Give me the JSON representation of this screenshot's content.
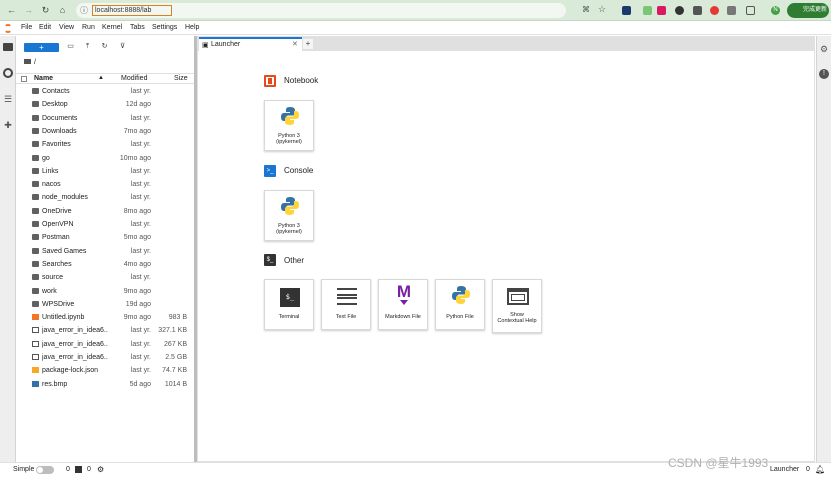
{
  "browser": {
    "url": "localhost:8888/lab",
    "update_label": "完成更新",
    "avatar": "N"
  },
  "menu": [
    "File",
    "Edit",
    "View",
    "Run",
    "Kernel",
    "Tabs",
    "Settings",
    "Help"
  ],
  "filebrowser": {
    "new_label": "+",
    "breadcrumb": "/",
    "col_name": "Name",
    "col_modified": "Modified",
    "col_size": "Size",
    "files": [
      {
        "name": "Contacts",
        "modified": "last yr.",
        "size": "",
        "type": "folder"
      },
      {
        "name": "Desktop",
        "modified": "12d ago",
        "size": "",
        "type": "folder"
      },
      {
        "name": "Documents",
        "modified": "last yr.",
        "size": "",
        "type": "folder"
      },
      {
        "name": "Downloads",
        "modified": "7mo ago",
        "size": "",
        "type": "folder"
      },
      {
        "name": "Favorites",
        "modified": "last yr.",
        "size": "",
        "type": "folder"
      },
      {
        "name": "go",
        "modified": "10mo ago",
        "size": "",
        "type": "folder"
      },
      {
        "name": "Links",
        "modified": "last yr.",
        "size": "",
        "type": "folder"
      },
      {
        "name": "nacos",
        "modified": "last yr.",
        "size": "",
        "type": "folder"
      },
      {
        "name": "node_modules",
        "modified": "last yr.",
        "size": "",
        "type": "folder"
      },
      {
        "name": "OneDrive",
        "modified": "8mo ago",
        "size": "",
        "type": "folder"
      },
      {
        "name": "OpenVPN",
        "modified": "last yr.",
        "size": "",
        "type": "folder"
      },
      {
        "name": "Postman",
        "modified": "5mo ago",
        "size": "",
        "type": "folder"
      },
      {
        "name": "Saved Games",
        "modified": "last yr.",
        "size": "",
        "type": "folder"
      },
      {
        "name": "Searches",
        "modified": "4mo ago",
        "size": "",
        "type": "folder"
      },
      {
        "name": "source",
        "modified": "last yr.",
        "size": "",
        "type": "folder"
      },
      {
        "name": "work",
        "modified": "9mo ago",
        "size": "",
        "type": "folder"
      },
      {
        "name": "WPSDrive",
        "modified": "19d ago",
        "size": "",
        "type": "folder"
      },
      {
        "name": "Untitled.ipynb",
        "modified": "9mo ago",
        "size": "983 B",
        "type": "notebook"
      },
      {
        "name": "java_error_in_idea6...",
        "modified": "last yr.",
        "size": "327.1 KB",
        "type": "file"
      },
      {
        "name": "java_error_in_idea6...",
        "modified": "last yr.",
        "size": "267 KB",
        "type": "file"
      },
      {
        "name": "java_error_in_idea6...",
        "modified": "last yr.",
        "size": "2.5 GB",
        "type": "file"
      },
      {
        "name": "package-lock.json",
        "modified": "last yr.",
        "size": "74.7 KB",
        "type": "json"
      },
      {
        "name": "res.bmp",
        "modified": "5d ago",
        "size": "1014 B",
        "type": "image"
      }
    ]
  },
  "launcher": {
    "tab_label": "Launcher",
    "notebook_title": "Notebook",
    "console_title": "Console",
    "other_title": "Other",
    "kernel_label": "Python 3 (ipykernel)",
    "terminal": "Terminal",
    "textfile": "Text File",
    "markdown": "Markdown File",
    "pythonfile": "Python File",
    "help": "Show Contextual Help",
    "terminal_glyph": "$_",
    "console_glyph": ">_",
    "other_glyph": "$_",
    "markdown_glyph": "M"
  },
  "statusbar": {
    "mode": "Simple",
    "count1": "0",
    "count2": "0",
    "launcher": "Launcher",
    "right_count": "0",
    "watermark": "CSDN @星牛1993"
  },
  "colors": {
    "accent": "#1976d2",
    "notebook": "#e64a19",
    "console": "#1976d2",
    "chrome": "#d9ead8"
  }
}
